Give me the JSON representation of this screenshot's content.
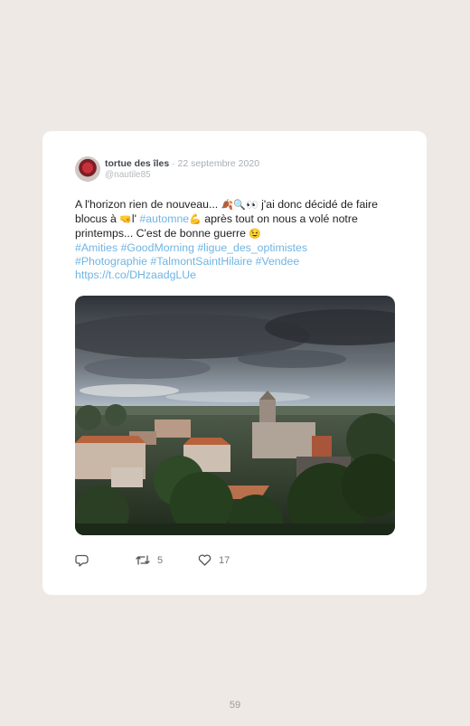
{
  "tweet": {
    "author_name": "tortue des îles",
    "separator": " · ",
    "date": "22 septembre 2020",
    "handle": "@nautile85",
    "text_1": "A l'horizon rien de nouveau... ",
    "emoji_1": "🍂🔍👀",
    "text_2": " j'ai donc décidé de faire blocus à ",
    "emoji_2": "🤜",
    "text_3": "l' ",
    "hashtag_automne": "#automne",
    "emoji_3": " 💪",
    "text_4": " après tout on nous a volé notre printemps... C'est de bonne guerre ",
    "emoji_4": "😉",
    "hashtags_line_1": "#Amities #GoodMorning #ligue_des_optimistes",
    "hashtags_line_2": "#Photographie #TalmontSaintHilaire #Vendee",
    "link": "https://t.co/DHzaadgLUe"
  },
  "actions": {
    "reply_icon": "reply-icon",
    "retweet_icon": "retweet-icon",
    "retweet_count": "5",
    "like_icon": "heart-icon",
    "like_count": "17"
  },
  "page_number": "59",
  "colors": {
    "background": "#efe9e6",
    "card": "#ffffff",
    "link": "#6fb4e3"
  }
}
